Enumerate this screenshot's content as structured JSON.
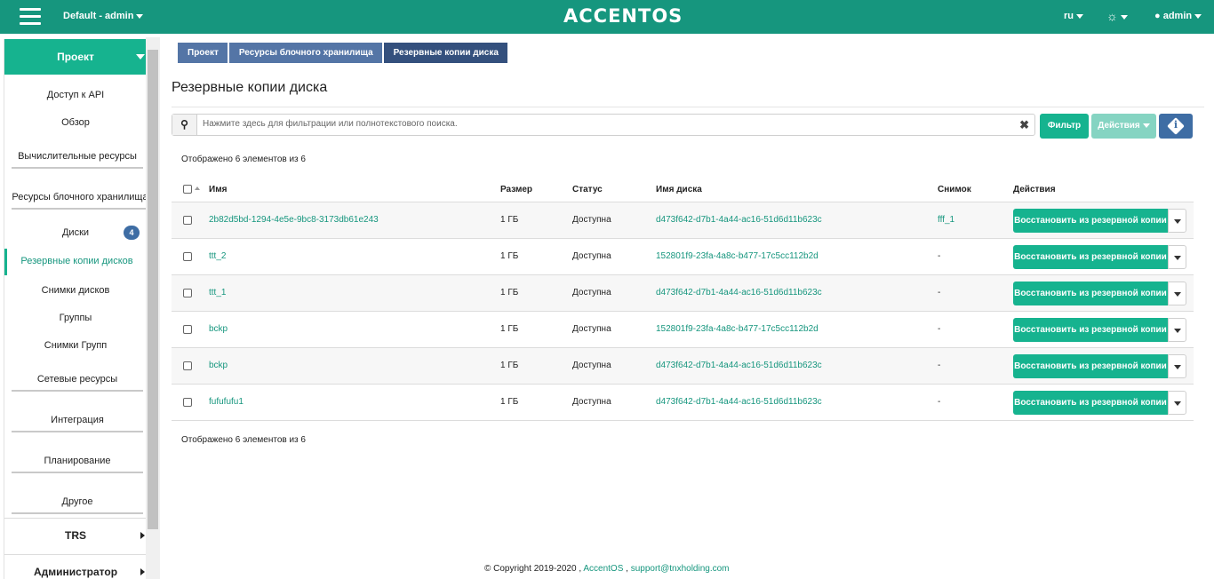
{
  "topbar": {
    "project": "Default - admin",
    "logo": "ACCENTOS",
    "lang": "ru",
    "user": "admin"
  },
  "sidebar": {
    "header": "Проект",
    "items": [
      {
        "label": "Доступ к API"
      },
      {
        "label": "Обзор"
      },
      {
        "label": "Вычислительные ресурсы"
      },
      {
        "label": "Ресурсы блочного хранилища"
      },
      {
        "label": "Диски",
        "badge": "4"
      },
      {
        "label": "Резервные копии дисков"
      },
      {
        "label": "Снимки дисков"
      },
      {
        "label": "Группы"
      },
      {
        "label": "Снимки Групп"
      },
      {
        "label": "Сетевые ресурсы"
      },
      {
        "label": "Интеграция"
      },
      {
        "label": "Планирование"
      },
      {
        "label": "Другое"
      }
    ],
    "sections": [
      "TRS",
      "Администратор"
    ]
  },
  "breadcrumb": [
    "Проект",
    "Ресурсы блочного хранилища",
    "Резервные копии диска"
  ],
  "page_title": "Резервные копии диска",
  "filter": {
    "placeholder": "Нажмите здесь для фильтрации или полнотекстового поиска.",
    "filter_button": "Фильтр",
    "actions_button": "Действия"
  },
  "count_text": "Отображено 6 элементов из 6",
  "table": {
    "columns": [
      "Имя",
      "Размер",
      "Статус",
      "Имя диска",
      "Снимок",
      "Действия"
    ],
    "rows": [
      {
        "name": "2b82d5bd-1294-4e5e-9bc8-3173db61e243",
        "size": "1 ГБ",
        "status": "Доступна",
        "volume": "d473f642-d7b1-4a44-ac16-51d6d11b623c",
        "snapshot": "fff_1",
        "action": "Восстановить из резервной копии"
      },
      {
        "name": "ttt_2",
        "size": "1 ГБ",
        "status": "Доступна",
        "volume": "152801f9-23fa-4a8c-b477-17c5cc112b2d",
        "snapshot": "-",
        "action": "Восстановить из резервной копии"
      },
      {
        "name": "ttt_1",
        "size": "1 ГБ",
        "status": "Доступна",
        "volume": "d473f642-d7b1-4a44-ac16-51d6d11b623c",
        "snapshot": "-",
        "action": "Восстановить из резервной копии"
      },
      {
        "name": "bckp",
        "size": "1 ГБ",
        "status": "Доступна",
        "volume": "152801f9-23fa-4a8c-b477-17c5cc112b2d",
        "snapshot": "-",
        "action": "Восстановить из резервной копии"
      },
      {
        "name": "bckp",
        "size": "1 ГБ",
        "status": "Доступна",
        "volume": "d473f642-d7b1-4a44-ac16-51d6d11b623c",
        "snapshot": "-",
        "action": "Восстановить из резервной копии"
      },
      {
        "name": "fufufufu1",
        "size": "1 ГБ",
        "status": "Доступна",
        "volume": "d473f642-d7b1-4a44-ac16-51d6d11b623c",
        "snapshot": "-",
        "action": "Восстановить из резервной копии"
      }
    ]
  },
  "footer": {
    "copyright": "© Copyright 2019-2020 ,",
    "link1": "AccentOS",
    "sep": ",",
    "link2": "support@tnxholding.com"
  },
  "colors": {
    "brand": "#16967e",
    "accent": "#16b38f",
    "nav_blue": "#3e6da4"
  }
}
